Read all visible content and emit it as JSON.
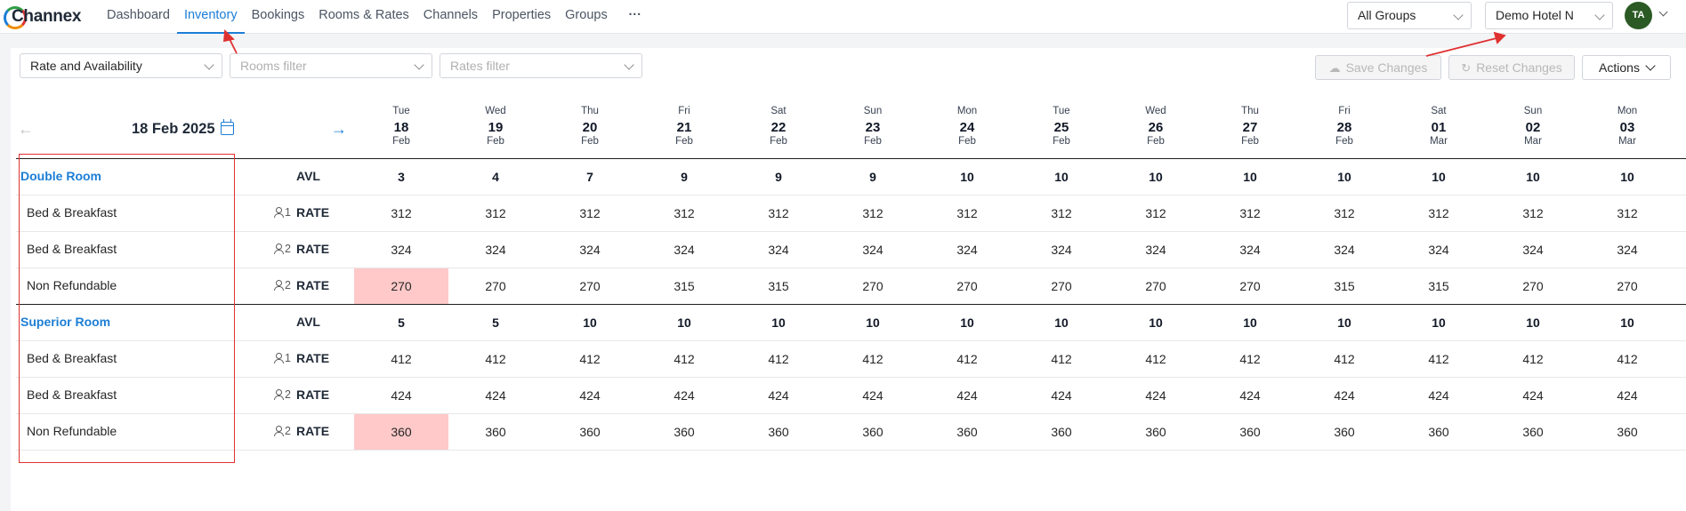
{
  "app": {
    "logo_text": "Channex"
  },
  "nav": {
    "items": [
      {
        "label": "Dashboard",
        "active": false
      },
      {
        "label": "Inventory",
        "active": true
      },
      {
        "label": "Bookings",
        "active": false
      },
      {
        "label": "Rooms & Rates",
        "active": false
      },
      {
        "label": "Channels",
        "active": false
      },
      {
        "label": "Properties",
        "active": false
      },
      {
        "label": "Groups",
        "active": false
      }
    ],
    "more": "···"
  },
  "header": {
    "group_select": "All Groups",
    "property_select": "Demo Hotel N",
    "avatar": "TA"
  },
  "toolbar": {
    "view_select": "Rate and Availability",
    "rooms_filter_placeholder": "Rooms filter",
    "rates_filter_placeholder": "Rates filter",
    "save_label": "Save Changes",
    "reset_label": "Reset Changes",
    "actions_label": "Actions"
  },
  "calendar": {
    "current_date": "18 Feb 2025",
    "days": [
      {
        "dow": "Tue",
        "day": "18",
        "mon": "Feb"
      },
      {
        "dow": "Wed",
        "day": "19",
        "mon": "Feb"
      },
      {
        "dow": "Thu",
        "day": "20",
        "mon": "Feb"
      },
      {
        "dow": "Fri",
        "day": "21",
        "mon": "Feb"
      },
      {
        "dow": "Sat",
        "day": "22",
        "mon": "Feb"
      },
      {
        "dow": "Sun",
        "day": "23",
        "mon": "Feb"
      },
      {
        "dow": "Mon",
        "day": "24",
        "mon": "Feb"
      },
      {
        "dow": "Tue",
        "day": "25",
        "mon": "Feb"
      },
      {
        "dow": "Wed",
        "day": "26",
        "mon": "Feb"
      },
      {
        "dow": "Thu",
        "day": "27",
        "mon": "Feb"
      },
      {
        "dow": "Fri",
        "day": "28",
        "mon": "Feb"
      },
      {
        "dow": "Sat",
        "day": "01",
        "mon": "Mar"
      },
      {
        "dow": "Sun",
        "day": "02",
        "mon": "Mar"
      },
      {
        "dow": "Mon",
        "day": "03",
        "mon": "Mar"
      }
    ]
  },
  "rows": [
    {
      "type": "room",
      "label": "Double Room",
      "kind": "AVL",
      "values": [
        "3",
        "4",
        "7",
        "9",
        "9",
        "9",
        "10",
        "10",
        "10",
        "10",
        "10",
        "10",
        "10",
        "10"
      ],
      "highlight": []
    },
    {
      "type": "rate",
      "label": "Bed & Breakfast",
      "occupancy": "1",
      "kind": "RATE",
      "values": [
        "312",
        "312",
        "312",
        "312",
        "312",
        "312",
        "312",
        "312",
        "312",
        "312",
        "312",
        "312",
        "312",
        "312"
      ],
      "highlight": []
    },
    {
      "type": "rate",
      "label": "Bed & Breakfast",
      "occupancy": "2",
      "kind": "RATE",
      "values": [
        "324",
        "324",
        "324",
        "324",
        "324",
        "324",
        "324",
        "324",
        "324",
        "324",
        "324",
        "324",
        "324",
        "324"
      ],
      "highlight": []
    },
    {
      "type": "rate",
      "label": "Non Refundable",
      "occupancy": "2",
      "kind": "RATE",
      "values": [
        "270",
        "270",
        "270",
        "315",
        "315",
        "270",
        "270",
        "270",
        "270",
        "270",
        "315",
        "315",
        "270",
        "270"
      ],
      "highlight": [
        0
      ]
    },
    {
      "type": "room",
      "label": "Superior Room",
      "kind": "AVL",
      "values": [
        "5",
        "5",
        "10",
        "10",
        "10",
        "10",
        "10",
        "10",
        "10",
        "10",
        "10",
        "10",
        "10",
        "10"
      ],
      "highlight": []
    },
    {
      "type": "rate",
      "label": "Bed & Breakfast",
      "occupancy": "1",
      "kind": "RATE",
      "values": [
        "412",
        "412",
        "412",
        "412",
        "412",
        "412",
        "412",
        "412",
        "412",
        "412",
        "412",
        "412",
        "412",
        "412"
      ],
      "highlight": []
    },
    {
      "type": "rate",
      "label": "Bed & Breakfast",
      "occupancy": "2",
      "kind": "RATE",
      "values": [
        "424",
        "424",
        "424",
        "424",
        "424",
        "424",
        "424",
        "424",
        "424",
        "424",
        "424",
        "424",
        "424",
        "424"
      ],
      "highlight": []
    },
    {
      "type": "rate",
      "label": "Non Refundable",
      "occupancy": "2",
      "kind": "RATE",
      "values": [
        "360",
        "360",
        "360",
        "360",
        "360",
        "360",
        "360",
        "360",
        "360",
        "360",
        "360",
        "360",
        "360",
        "360"
      ],
      "highlight": [
        0
      ]
    }
  ],
  "colors": {
    "accent": "#1c7ed6",
    "highlight": "#ffc9c9",
    "annotation": "#e03131",
    "avatar": "#2b5a24"
  }
}
